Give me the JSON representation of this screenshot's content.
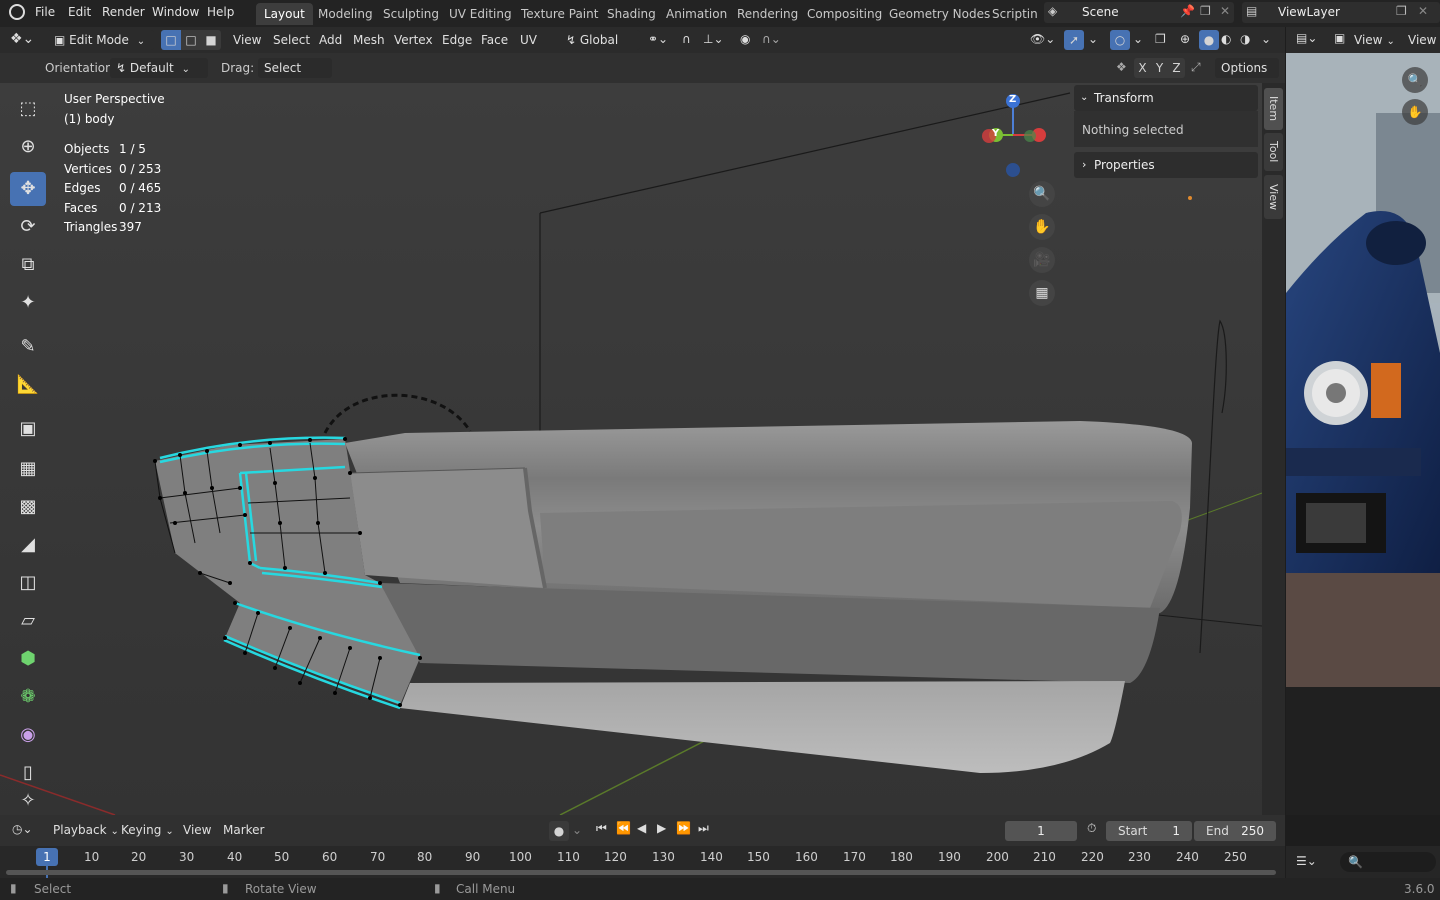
{
  "app": {
    "menu": [
      "File",
      "Edit",
      "Render",
      "Window",
      "Help"
    ],
    "workspaces": [
      "Layout",
      "Modeling",
      "Sculpting",
      "UV Editing",
      "Texture Paint",
      "Shading",
      "Animation",
      "Rendering",
      "Compositing",
      "Geometry Nodes",
      "Scripting"
    ],
    "active_workspace": "Layout",
    "scene": "Scene",
    "view_layer": "ViewLayer"
  },
  "header": {
    "mode": "Edit Mode",
    "menus": [
      "View",
      "Select",
      "Add",
      "Mesh",
      "Vertex",
      "Edge",
      "Face",
      "UV"
    ],
    "transform_orientation": "Global",
    "orientation_label": "Orientation:",
    "orientation_value": "Default",
    "drag_label": "Drag:",
    "drag_value": "Select Box",
    "axes": [
      "X",
      "Y",
      "Z"
    ],
    "options": "Options"
  },
  "viewport": {
    "perspective": "User Perspective",
    "object": "(1) body",
    "stats": [
      {
        "label": "Objects",
        "value": "1 / 5"
      },
      {
        "label": "Vertices",
        "value": "0 / 253"
      },
      {
        "label": "Edges",
        "value": "0 / 465"
      },
      {
        "label": "Faces",
        "value": "0 / 213"
      },
      {
        "label": "Triangles",
        "value": "397"
      }
    ],
    "gizmo": {
      "z": "Z",
      "y": "Y"
    }
  },
  "sidebar": {
    "transform": "Transform",
    "nothing_selected": "Nothing selected",
    "properties": "Properties",
    "tabs": [
      "Item",
      "Tool",
      "View"
    ]
  },
  "image_editor": {
    "view": "View",
    "view2": "View"
  },
  "timeline": {
    "menus": [
      "Playback",
      "Keying",
      "View",
      "Marker"
    ],
    "current_frame": "1",
    "start_label": "Start",
    "start": "1",
    "end_label": "End",
    "end": "250",
    "ruler": [
      "1",
      "10",
      "20",
      "30",
      "40",
      "50",
      "60",
      "70",
      "80",
      "90",
      "100",
      "110",
      "120",
      "130",
      "140",
      "150",
      "160",
      "170",
      "180",
      "190",
      "200",
      "210",
      "220",
      "230",
      "240",
      "250"
    ]
  },
  "status": {
    "left": "Select",
    "middle": "Rotate View",
    "right": "Call Menu",
    "version": "3.6.0"
  }
}
